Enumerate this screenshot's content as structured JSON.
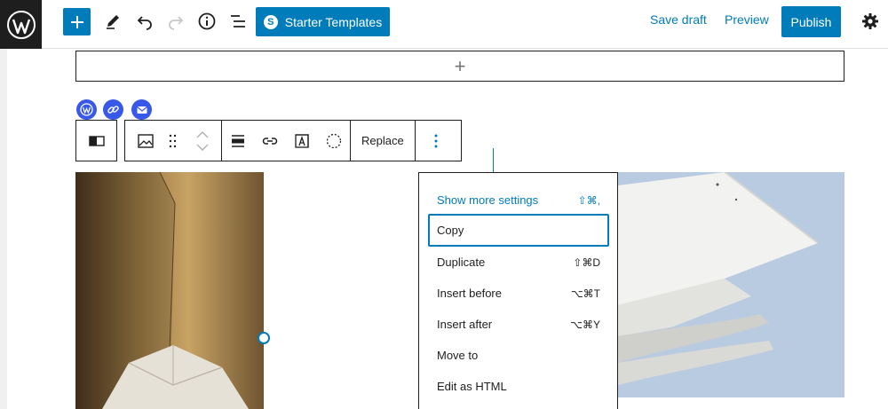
{
  "topbar": {
    "starter_templates_label": "Starter Templates",
    "starter_badge": "S",
    "save_draft_label": "Save draft",
    "preview_label": "Preview",
    "publish_label": "Publish"
  },
  "canvas": {
    "appender_symbol": "+"
  },
  "block_toolbar": {
    "replace_label": "Replace"
  },
  "menu": {
    "items": [
      {
        "label": "Show more settings",
        "shortcut": "⇧⌘,"
      },
      {
        "label": "Copy",
        "shortcut": ""
      },
      {
        "label": "Duplicate",
        "shortcut": "⇧⌘D"
      },
      {
        "label": "Insert before",
        "shortcut": "⌥⌘T"
      },
      {
        "label": "Insert after",
        "shortcut": "⌥⌘Y"
      },
      {
        "label": "Move to",
        "shortcut": ""
      },
      {
        "label": "Edit as HTML",
        "shortcut": ""
      }
    ]
  },
  "colors": {
    "accent": "#007cba",
    "dark": "#1e1e1e",
    "icon_blue": "#3858e9"
  }
}
